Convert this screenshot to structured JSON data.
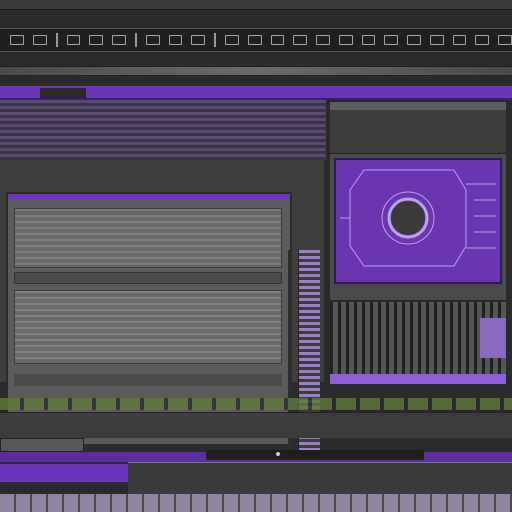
{
  "app": {
    "toolbar_icons": [
      "undo-icon",
      "redo-icon",
      "cut-icon",
      "copy-icon",
      "paste-icon",
      "zoom-icon",
      "grid-icon",
      "layer-icon",
      "measure-icon",
      "snap-icon",
      "settings-icon"
    ],
    "accent": "#6b35b8"
  },
  "left_panel": {
    "title": ""
  },
  "right_panel": {
    "preview_caption": ""
  },
  "timeline": {
    "scrub_position": 0.33
  }
}
